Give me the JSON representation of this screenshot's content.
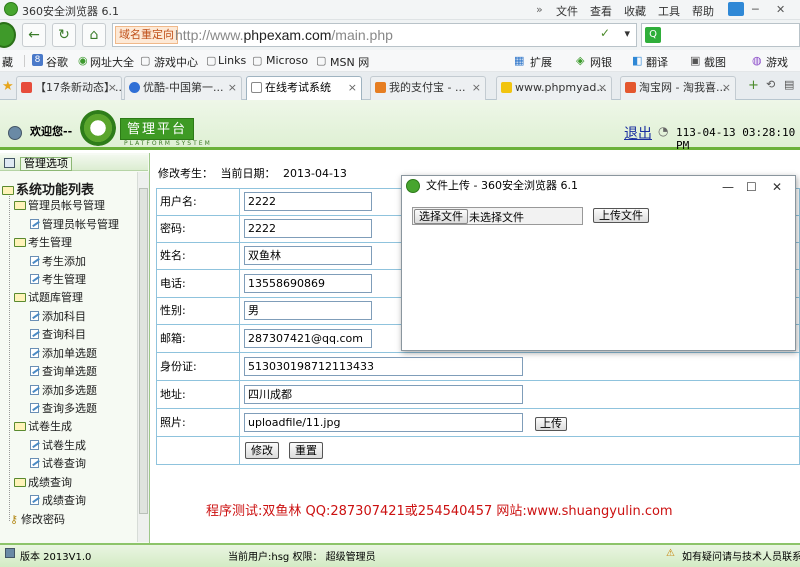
{
  "browser": {
    "title": "360安全浏览器 6.1",
    "menus": [
      "文件",
      "查看",
      "收藏",
      "工具",
      "帮助"
    ],
    "address_tag": "域名重定向",
    "url_prefix": "http://www.",
    "url_domain": "phpexam.com",
    "url_path": "/main.php",
    "bookmarks": [
      "藏",
      "谷歌",
      "网址大全",
      "游戏中心",
      "Links",
      "Microso",
      "MSN 网"
    ],
    "toolbar_right": [
      "扩展",
      "网银",
      "翻译",
      "截图",
      "游戏"
    ],
    "tabs": [
      {
        "label": "【17条新动态】...",
        "active": false,
        "color": "#e74c3c"
      },
      {
        "label": "优酷-中国第一...",
        "active": false,
        "color": "#2f6fd6"
      },
      {
        "label": "在线考试系统",
        "active": true,
        "color": "#ffffff"
      },
      {
        "label": "我的支付宝 - ...",
        "active": false,
        "color": "#e67e22"
      },
      {
        "label": "www.phpmyad...",
        "active": false,
        "color": "#f1c40f"
      },
      {
        "label": "淘宝网 - 淘我喜...",
        "active": false,
        "color": "#e4572e"
      }
    ]
  },
  "header": {
    "welcome": "欢迎您--",
    "logo_text": "管理平台",
    "logo_sub": "PLATFORM SYSTEM",
    "logout": "退出",
    "datetime": "113-04-13 03:28:10 PM"
  },
  "sidebar": {
    "options_label": "管理选项",
    "title": "系统功能列表",
    "groups": [
      {
        "label": "管理员帐号管理",
        "items": [
          "管理员帐号管理"
        ]
      },
      {
        "label": "考生管理",
        "items": [
          "考生添加",
          "考生管理"
        ]
      },
      {
        "label": "试题库管理",
        "items": [
          "添加科目",
          "查询科目",
          "添加单选题",
          "查询单选题",
          "添加多选题",
          "查询多选题"
        ]
      },
      {
        "label": "试卷生成",
        "items": [
          "试卷生成",
          "试卷查询"
        ]
      },
      {
        "label": "成绩查询",
        "items": [
          "成绩查询"
        ]
      }
    ],
    "last_item": "修改密码"
  },
  "main": {
    "edit_title": "修改考生：",
    "date_label": "当前日期：",
    "date_value": "2013-04-13",
    "fields": [
      {
        "label": "用户名:",
        "value": "2222"
      },
      {
        "label": "密码:",
        "value": "2222"
      },
      {
        "label": "姓名:",
        "value": "双鱼林"
      },
      {
        "label": "电话:",
        "value": "13558690869"
      },
      {
        "label": "性别:",
        "value": "男"
      },
      {
        "label": "邮箱:",
        "value": "287307421@qq.com"
      },
      {
        "label": "身份证:",
        "value": "513030198712113433"
      },
      {
        "label": "地址:",
        "value": "四川成都"
      },
      {
        "label": "照片:",
        "value": "uploadfile/11.jpg"
      }
    ],
    "upload_button": "上传",
    "modify_button": "修改",
    "reset_button": "重置",
    "promo": "程序测试:双鱼林 QQ:287307421或254540457 网站:www.shuangyulin.com"
  },
  "popup": {
    "title": "文件上传 - 360安全浏览器 6.1",
    "choose_button": "选择文件",
    "no_file": "未选择文件",
    "upload_button": "上传文件"
  },
  "status": {
    "version": "版本 2013V1.0",
    "user": "当前用户:hsg 权限： 超级管理员",
    "help": "如有疑问请与技术人员联系"
  }
}
